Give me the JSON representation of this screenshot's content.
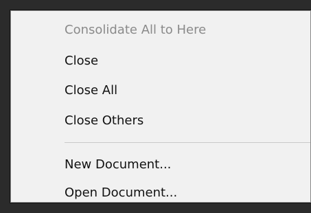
{
  "context_menu": {
    "items": [
      {
        "label": "Consolidate All to Here",
        "disabled": true
      },
      {
        "label": "Close"
      },
      {
        "label": "Close All"
      },
      {
        "label": "Close Others"
      },
      {
        "label": "New Document..."
      },
      {
        "label": "Open Document..."
      }
    ]
  }
}
